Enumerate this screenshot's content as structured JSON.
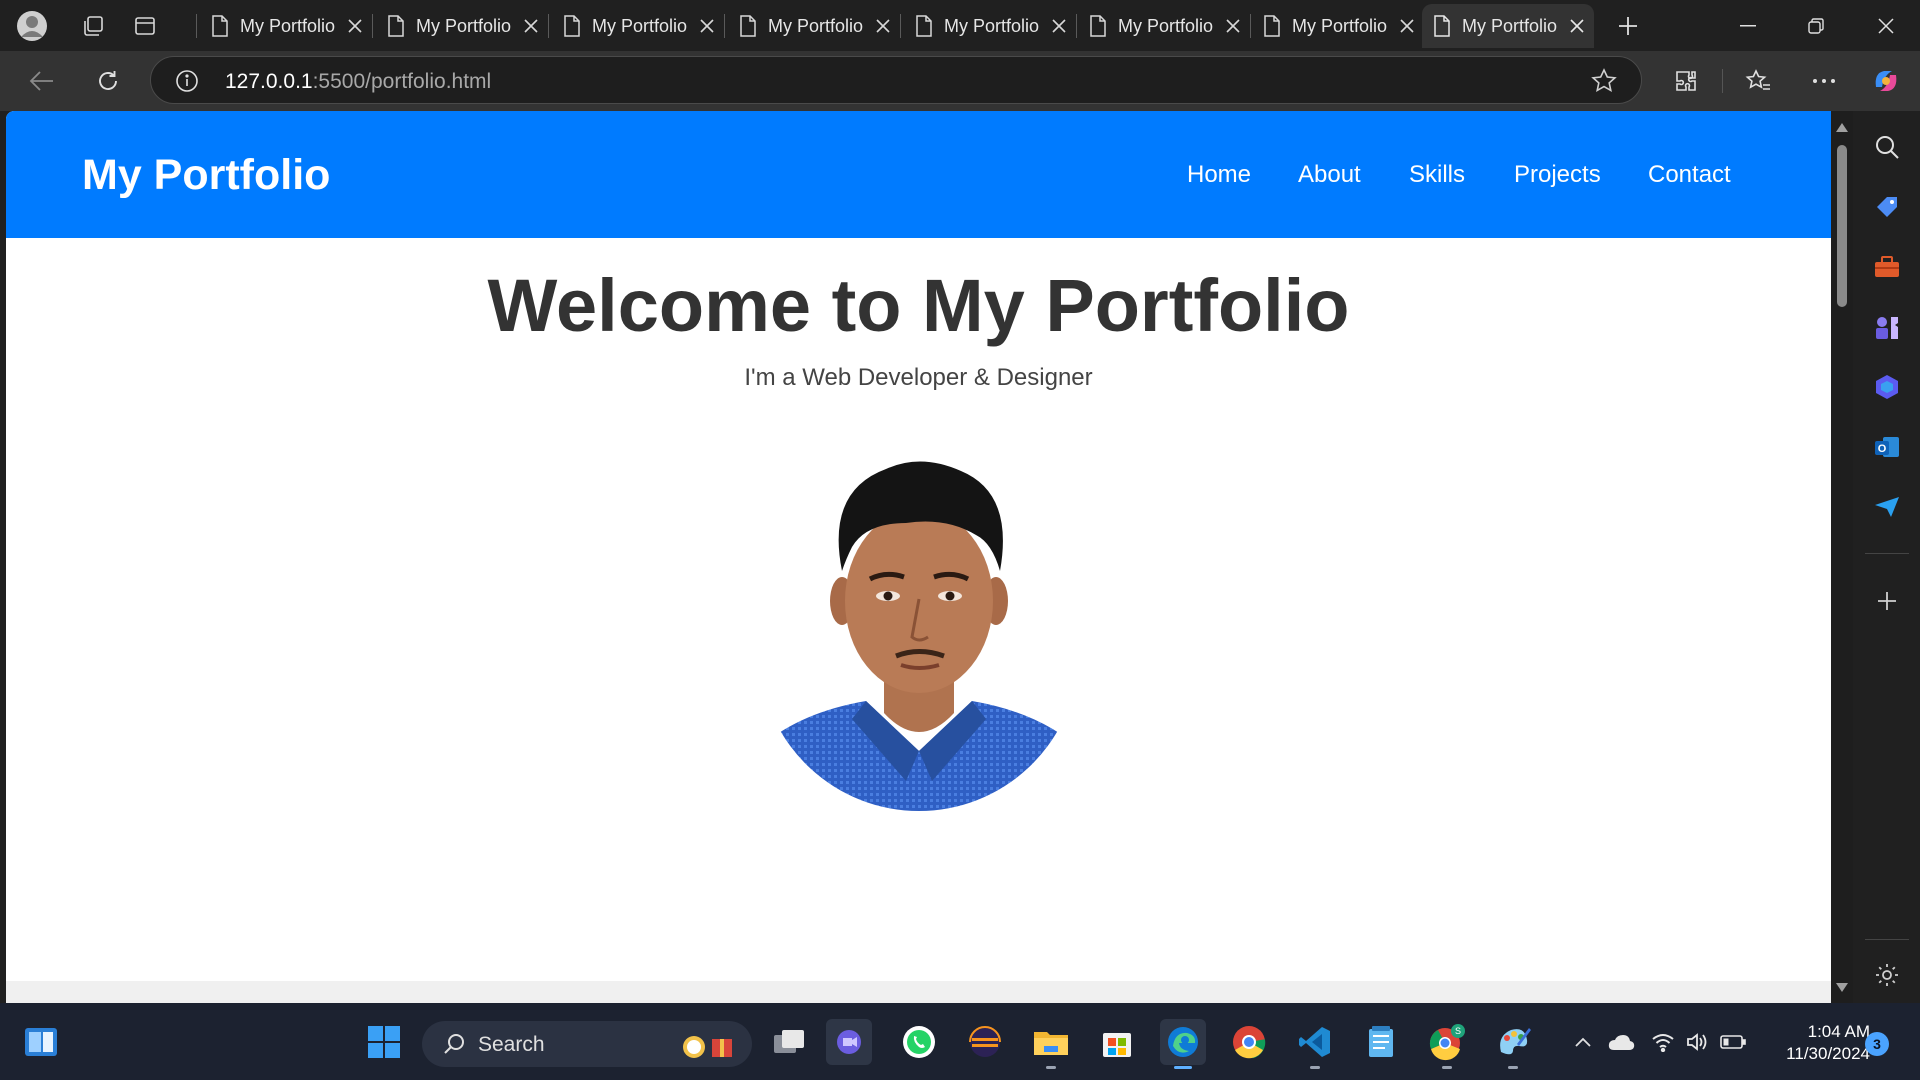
{
  "browser": {
    "tabs": [
      {
        "title": "My Portfolio",
        "active": false
      },
      {
        "title": "My Portfolio",
        "active": false
      },
      {
        "title": "My Portfolio",
        "active": false
      },
      {
        "title": "My Portfolio",
        "active": false
      },
      {
        "title": "My Portfolio",
        "active": false
      },
      {
        "title": "My Portfolio",
        "active": false
      },
      {
        "title": "My Portfolio",
        "active": false
      },
      {
        "title": "My Portfolio",
        "active": true
      }
    ],
    "address": {
      "host": "127.0.0.1",
      "path": ":5500/portfolio.html"
    }
  },
  "page": {
    "logo": "My Portfolio",
    "nav": [
      "Home",
      "About",
      "Skills",
      "Projects",
      "Contact"
    ],
    "hero_title": "Welcome to My Portfolio",
    "hero_subtitle": "I'm a Web Developer & Designer",
    "header_color": "#007bff"
  },
  "taskbar": {
    "search_label": "Search",
    "time": "1:04 AM",
    "date": "11/30/2024",
    "notification_count": "3"
  },
  "icons": {
    "sidebar": [
      "search-icon",
      "tag-icon",
      "toolbox-icon",
      "games-icon",
      "copilot-icon",
      "outlook-icon",
      "send-icon",
      "add-icon",
      "settings-icon"
    ],
    "taskbar": [
      "widgets-icon",
      "start-icon",
      "task-view-icon",
      "meet-icon",
      "whatsapp-icon",
      "eclipse-icon",
      "file-explorer-icon",
      "store-icon",
      "edge-icon",
      "chrome-icon",
      "vscode-icon",
      "notepad-icon",
      "chrome-profile-icon",
      "paint-icon"
    ]
  }
}
